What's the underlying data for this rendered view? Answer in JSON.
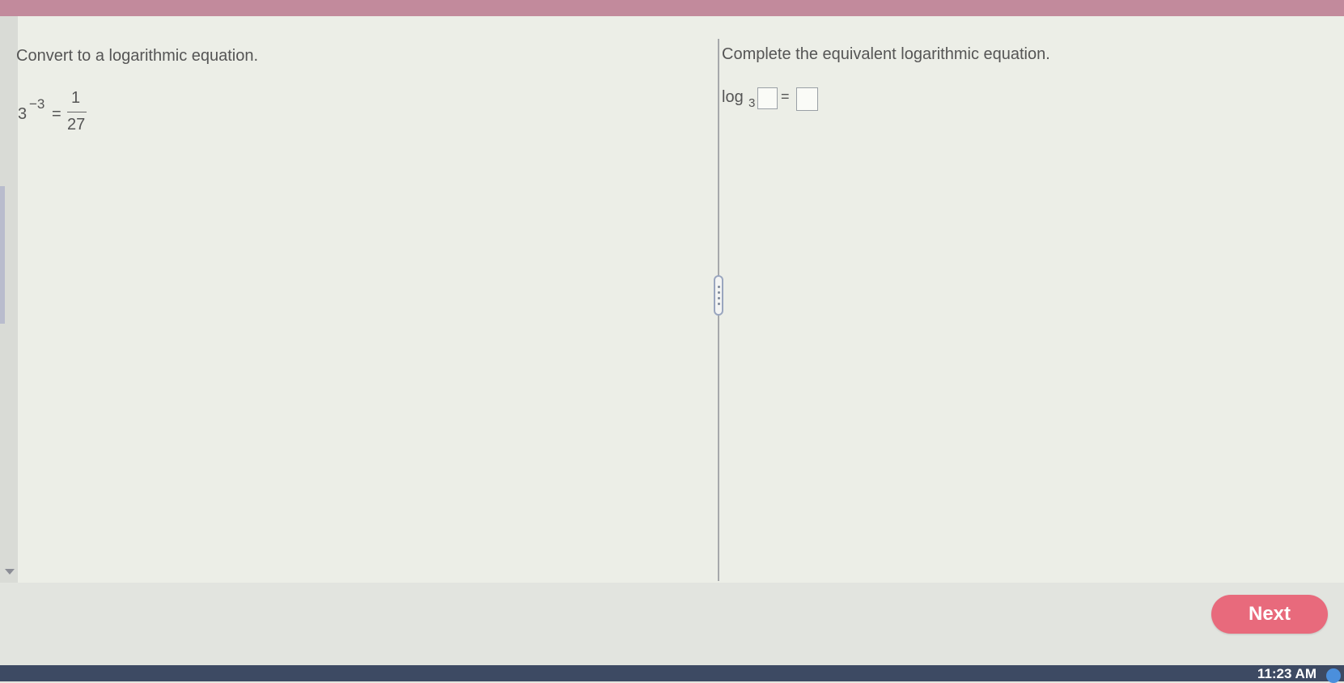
{
  "left_pane": {
    "instruction": "Convert to a logarithmic equation.",
    "equation": {
      "base": "3",
      "exponent": "−3",
      "equals": "=",
      "numerator": "1",
      "denominator": "27"
    }
  },
  "right_pane": {
    "instruction": "Complete the equivalent logarithmic equation.",
    "log_label": "log",
    "log_base": "3",
    "equals": "=",
    "answer_argument": "",
    "answer_value": ""
  },
  "footer": {
    "next_label": "Next"
  },
  "taskbar": {
    "time": "11:23 AM"
  },
  "colors": {
    "next_button": "#e86a7c",
    "top_bar": "#c28a9c",
    "taskbar": "#3d4a63"
  }
}
